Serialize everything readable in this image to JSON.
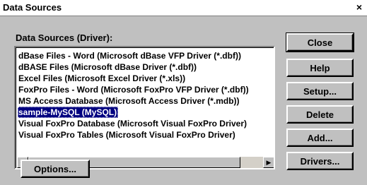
{
  "window": {
    "title": "Data Sources",
    "close_glyph": "×"
  },
  "list": {
    "label": "Data Sources (Driver):",
    "items": [
      "dBase Files - Word (Microsoft dBase VFP Driver (*.dbf))",
      "dBASE Files (Microsoft dBase Driver (*.dbf))",
      "Excel Files (Microsoft Excel Driver (*.xls))",
      "FoxPro Files - Word (Microsoft FoxPro VFP Driver (*.dbf))",
      "MS Access Database (Microsoft Access Driver (*.mdb))",
      "sample-MySQL (MySQL)",
      "Visual FoxPro Database (Microsoft Visual FoxPro Driver)",
      "Visual FoxPro Tables (Microsoft Visual FoxPro Driver)"
    ],
    "selected_index": 5,
    "scroll_left_glyph": "◀",
    "scroll_right_glyph": "▶"
  },
  "buttons": {
    "close": "Close",
    "help": "Help",
    "setup": "Setup...",
    "delete": "Delete",
    "add": "Add...",
    "drivers": "Drivers...",
    "options": "Options..."
  }
}
